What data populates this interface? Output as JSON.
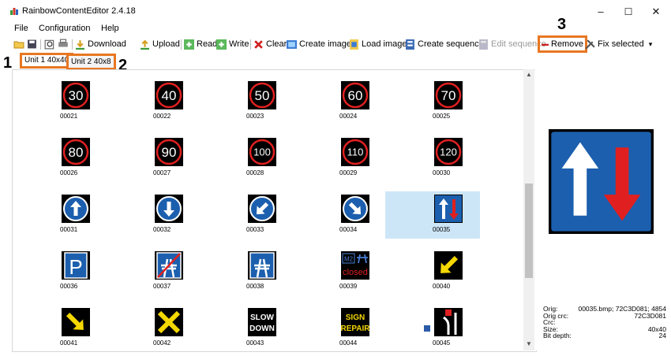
{
  "window": {
    "title": "RainbowContentEditor 2.4.18",
    "minimize": "–",
    "maximize": "☐",
    "close": "✕"
  },
  "menu": [
    "File",
    "Configuration",
    "Help"
  ],
  "toolbar": {
    "download": "Download",
    "upload": "Upload",
    "read": "Read",
    "write": "Write",
    "clear": "Clear",
    "create_image": "Create image",
    "load_image": "Load image",
    "create_sequence": "Create sequence",
    "edit_sequence": "Edit sequence",
    "remove": "Remove",
    "fix_selected": "Fix selected",
    "dropdown": "▾"
  },
  "tabs": [
    "Unit 1 40x40",
    "Unit 2 40x8"
  ],
  "callouts": [
    "1",
    "2",
    "3"
  ],
  "images": [
    {
      "label": "00021",
      "sign": "speed",
      "text": "30"
    },
    {
      "label": "00022",
      "sign": "speed",
      "text": "40"
    },
    {
      "label": "00023",
      "sign": "speed",
      "text": "50"
    },
    {
      "label": "00024",
      "sign": "speed",
      "text": "60"
    },
    {
      "label": "00025",
      "sign": "speed",
      "text": "70"
    },
    {
      "label": "00026",
      "sign": "speed",
      "text": "80"
    },
    {
      "label": "00027",
      "sign": "speed",
      "text": "90"
    },
    {
      "label": "00028",
      "sign": "speed",
      "text": "100"
    },
    {
      "label": "00029",
      "sign": "speed",
      "text": "110"
    },
    {
      "label": "00030",
      "sign": "speed",
      "text": "120"
    },
    {
      "label": "00031",
      "sign": "arrow-up"
    },
    {
      "label": "00032",
      "sign": "arrow-down"
    },
    {
      "label": "00033",
      "sign": "arrow-down-left"
    },
    {
      "label": "00034",
      "sign": "arrow-down-right"
    },
    {
      "label": "00035",
      "sign": "priority-oncoming",
      "selected": true
    },
    {
      "label": "00036",
      "sign": "parking",
      "text": "P"
    },
    {
      "label": "00037",
      "sign": "motorway-end"
    },
    {
      "label": "00038",
      "sign": "motorway"
    },
    {
      "label": "00039",
      "sign": "closed",
      "text": "M2",
      "text2": "closed"
    },
    {
      "label": "00040",
      "sign": "yellow-arrow-down-left"
    },
    {
      "label": "00041",
      "sign": "yellow-arrow-down-right"
    },
    {
      "label": "00042",
      "sign": "yellow-cross"
    },
    {
      "label": "00043",
      "sign": "text",
      "text": "SLOW",
      "text2": "DOWN"
    },
    {
      "label": "00044",
      "sign": "text-yellow",
      "text": "SIGN",
      "text2": "REPAIR"
    },
    {
      "label": "00045",
      "sign": "lane-merge"
    }
  ],
  "info": [
    {
      "key": "Orig:",
      "value": "00035.bmp; 72C3D081; 4854"
    },
    {
      "key": "Orig crc:",
      "value": "72C3D081"
    },
    {
      "key": "Crc:",
      "value": ""
    },
    {
      "key": "Size:",
      "value": "40x40"
    },
    {
      "key": "Bit depth:",
      "value": "24"
    }
  ],
  "colors": {
    "accent": "#e87722",
    "selection": "#cde6f7",
    "sign_blue": "#1c5fae",
    "sign_red": "#e02020",
    "sign_yellow": "#f5d800"
  }
}
